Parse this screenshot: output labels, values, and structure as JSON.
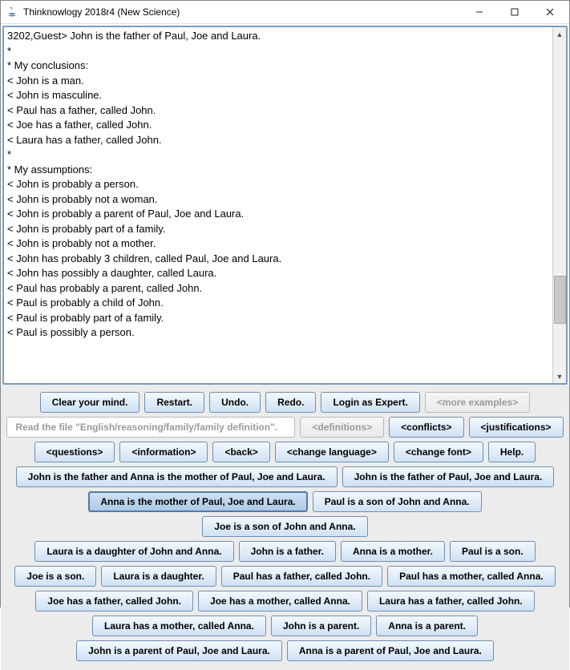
{
  "window": {
    "title": "Thinknowlogy 2018r4 (New Science)"
  },
  "console": {
    "lines": [
      "3202,Guest> John is the father of Paul, Joe and Laura.",
      "*",
      "* My conclusions:",
      "< John is a man.",
      "< John is masculine.",
      "< Paul has a father, called John.",
      "< Joe has a father, called John.",
      "< Laura has a father, called John.",
      "*",
      "* My assumptions:",
      "< John is probably a person.",
      "< John is probably not a woman.",
      "< John is probably a parent of Paul, Joe and Laura.",
      "< John is probably part of a family.",
      "< John is probably not a mother.",
      "< John has probably 3 children, called Paul, Joe and Laura.",
      "< John has possibly a daughter, called Laura.",
      "< Paul has probably a parent, called John.",
      "< Paul is probably a child of John.",
      "< Paul is probably part of a family.",
      "< Paul is possibly a person."
    ]
  },
  "toolbar1": {
    "clear": "Clear your mind.",
    "restart": "Restart.",
    "undo": "Undo.",
    "redo": "Redo.",
    "login": "Login as Expert.",
    "more": "<more examples>"
  },
  "toolbar2": {
    "readfile_placeholder": "Read the file \"English/reasoning/family/family definition\".",
    "definitions": "<definitions>",
    "conflicts": "<conflicts>",
    "justifications": "<justifications>"
  },
  "toolbar3": {
    "questions": "<questions>",
    "information": "<information>",
    "back": "<back>",
    "changelang": "<change language>",
    "changefont": "<change font>",
    "help": "Help."
  },
  "examples": {
    "r1": [
      "John is the father and Anna is the mother of Paul, Joe and Laura.",
      "John is the father of Paul, Joe and Laura."
    ],
    "r2": [
      "Anna is the mother of Paul, Joe and Laura.",
      "Paul is a son of John and Anna.",
      "Joe is a son of John and Anna."
    ],
    "r3": [
      "Laura is a daughter of John and Anna.",
      "John is a father.",
      "Anna is a mother.",
      "Paul is a son."
    ],
    "r4": [
      "Joe is a son.",
      "Laura is a daughter.",
      "Paul has a father, called John.",
      "Paul has a mother, called Anna."
    ],
    "r5": [
      "Joe has a father, called John.",
      "Joe has a mother, called Anna.",
      "Laura has a father, called John."
    ],
    "r6": [
      "Laura has a mother, called Anna.",
      "John is a parent.",
      "Anna is a parent."
    ],
    "r7": [
      "John is a parent of Paul, Joe and Laura.",
      "Anna is a parent of Paul, Joe and Laura."
    ]
  }
}
